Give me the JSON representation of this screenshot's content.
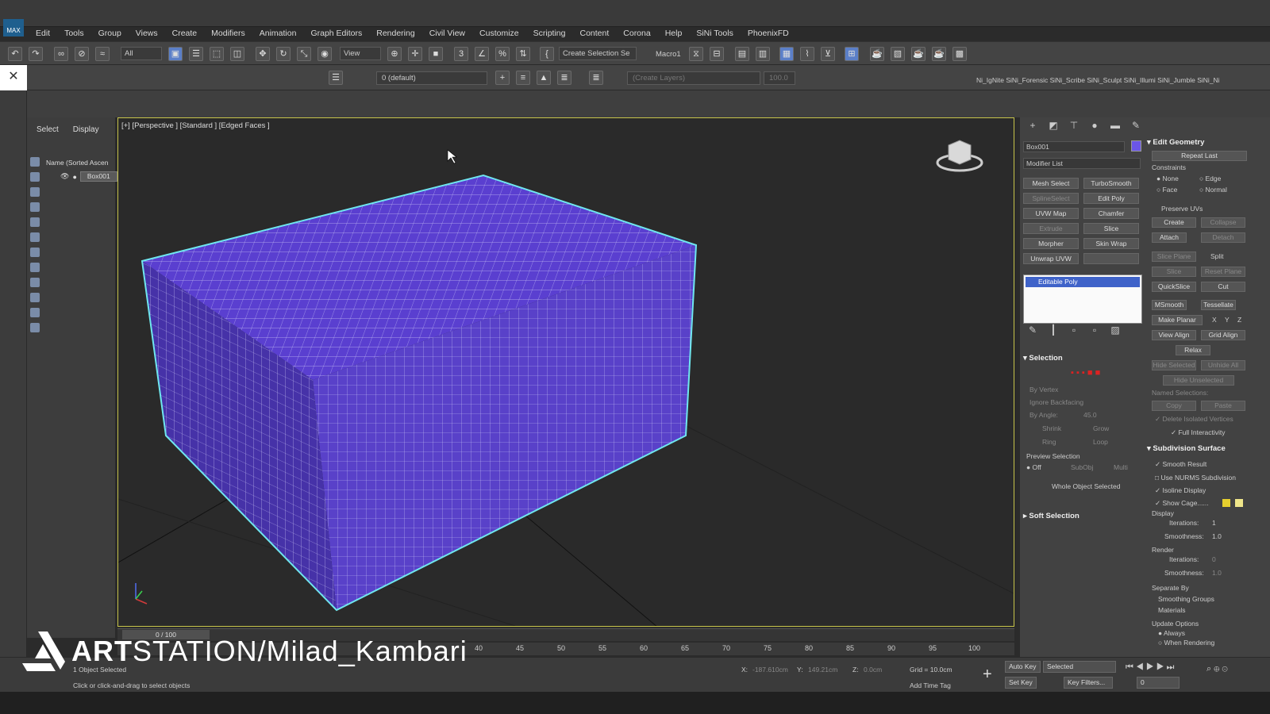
{
  "app": {
    "icon_label": "MAX"
  },
  "menubar": [
    "Edit",
    "Tools",
    "Group",
    "Views",
    "Create",
    "Modifiers",
    "Animation",
    "Graph Editors",
    "Rendering",
    "Civil View",
    "Customize",
    "Scripting",
    "Content",
    "Corona",
    "Help",
    "SiNi Tools",
    "PhoenixFD"
  ],
  "toolbar": {
    "filter_value": "All",
    "ref_coord_value": "View",
    "selection_set_placeholder": "Create Selection Se",
    "macro_label": "Macro1"
  },
  "toolbar2": {
    "layer_value": "0 (default)",
    "layer_filter_placeholder": "(Create Layers)",
    "spin_value": "100.0",
    "plugins_text": "Ni_IgNite  SiNi_Forensic  SiNi_Scribe  SiNi_Sculpt  SiNi_Illumi  SiNi_Jumble  SiNi_Ni"
  },
  "scene_explorer": {
    "tabs": [
      "Select",
      "Display"
    ],
    "column_header": "Name (Sorted Ascen",
    "items": [
      "Box001"
    ]
  },
  "viewport": {
    "label": "[+] [Perspective ] [Standard ] [Edged Faces ]"
  },
  "command_panel": {
    "object_name": "Box001",
    "object_color": "#6b56e8",
    "modifier_list": "Modifier List",
    "modifier_buttons": [
      [
        "Mesh Select",
        "TurboSmooth"
      ],
      [
        "SplineSelect",
        "Edit Poly"
      ],
      [
        "UVW Map",
        "Chamfer"
      ],
      [
        "Extrude",
        "Slice"
      ],
      [
        "Morpher",
        "Skin Wrap"
      ],
      [
        "Unwrap UVW",
        ""
      ]
    ],
    "stack_item": "Editable Poly",
    "selection": {
      "title": "Selection",
      "by_vertex": "By Vertex",
      "ignore_backfacing": "Ignore Backfacing",
      "by_angle": "By Angle:",
      "by_angle_value": "45.0",
      "shrink": "Shrink",
      "grow": "Grow",
      "ring": "Ring",
      "loop": "Loop",
      "preview_selection": "Preview Selection",
      "off": "Off",
      "subobj": "SubObj",
      "multi": "Multi",
      "status": "Whole Object Selected"
    },
    "soft_selection": "Soft Selection",
    "edit_geometry": {
      "title": "Edit Geometry",
      "repeat_last": "Repeat Last",
      "constraints": "Constraints",
      "none": "None",
      "edge": "Edge",
      "face": "Face",
      "normal": "Normal",
      "preserve_uvs": "Preserve UVs",
      "create": "Create",
      "collapse": "Collapse",
      "attach": "Attach",
      "detach": "Detach",
      "slice_plane": "Slice Plane",
      "split": "Split",
      "slice": "Slice",
      "reset_plane": "Reset Plane",
      "quickslice": "QuickSlice",
      "cut": "Cut",
      "msmooth": "MSmooth",
      "tessellate": "Tessellate",
      "make_planar": "Make Planar",
      "x": "X",
      "y": "Y",
      "z": "Z",
      "view_align": "View Align",
      "grid_align": "Grid Align",
      "relax": "Relax",
      "hide_selected": "Hide Selected",
      "unhide_all": "Unhide All",
      "hide_unselected": "Hide Unselected",
      "named_selections": "Named Selections:",
      "copy": "Copy",
      "paste": "Paste",
      "delete_isolated": "Delete Isolated Vertices",
      "full_interactivity": "Full Interactivity"
    },
    "subdivision_surface": {
      "title": "Subdivision Surface",
      "smooth_result": "Smooth Result",
      "use_nurms": "Use NURMS Subdivision",
      "isoline_display": "Isoline Display",
      "show_cage": "Show Cage......",
      "display": "Display",
      "iterations": "Iterations:",
      "iterations_value": "1",
      "smoothness": "Smoothness:",
      "smoothness_value": "1.0",
      "render": "Render",
      "render_iterations_value": "0",
      "render_smoothness_value": "1.0",
      "separate_by": "Separate By",
      "smoothing_groups": "Smoothing Groups",
      "materials": "Materials",
      "update_options": "Update Options",
      "always": "Always",
      "when_rendering": "When Rendering"
    }
  },
  "timeline": {
    "counter": "0 / 100",
    "ticks": [
      "40",
      "45",
      "50",
      "55",
      "60",
      "65",
      "70",
      "75",
      "80",
      "85",
      "90",
      "95",
      "100"
    ]
  },
  "status": {
    "selected_text": "1 Object Selected",
    "prompt": "Click or click-and-drag to select objects",
    "x_label": "X:",
    "x_value": "-187.610cm",
    "y_label": "Y:",
    "y_value": "149.21cm",
    "z_label": "Z:",
    "z_value": "0.0cm",
    "grid": "Grid = 10.0cm",
    "add_time_tag": "Add Time Tag",
    "auto_key": "Auto Key",
    "set_key": "Set Key",
    "selected_dd": "Selected",
    "key_filters": "Key Filters...",
    "frame_value": "0"
  },
  "watermark": {
    "art": "ART",
    "rest": "STATION/Milad_Kambari"
  }
}
